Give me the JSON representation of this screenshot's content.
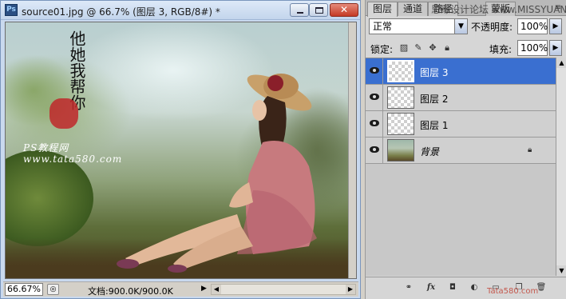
{
  "document": {
    "title": "source01.jpg @ 66.7% (图层 3, RGB/8#) *",
    "app_icon": "Ps",
    "buttons": {
      "minimize": "minimize-icon",
      "maximize": "maximize-icon",
      "close": "✕"
    },
    "image_overlay": {
      "calligraphy": "他她我帮你",
      "site_label": "PS教程网",
      "site_url": "www.tata580.com"
    },
    "status": {
      "zoom": "66.67%",
      "doc_info": "文档:900.0K/900.0K"
    }
  },
  "panel": {
    "tabs": [
      "图层",
      "通道",
      "路径",
      "蒙版"
    ],
    "watermark": "思缘设计论坛 www.MISSYUAN.COM",
    "blend_mode": "正常",
    "opacity_label": "不透明度:",
    "opacity_value": "100%",
    "lock_label": "锁定:",
    "fill_label": "填充:",
    "fill_value": "100%",
    "layers": [
      {
        "name": "图层 3",
        "selected": true,
        "type": "transparent"
      },
      {
        "name": "图层 2",
        "selected": false,
        "type": "transparent"
      },
      {
        "name": "图层 1",
        "selected": false,
        "type": "transparent"
      },
      {
        "name": "背景",
        "selected": false,
        "type": "photo",
        "locked": true
      }
    ],
    "footer_icons": [
      "link-icon",
      "fx-icon",
      "mask-icon",
      "adjustment-icon",
      "group-folder-icon",
      "new-layer-icon",
      "trash-icon"
    ],
    "footer_watermark": "Tata580.com"
  },
  "colors": {
    "selection": "#3a6fd0",
    "titlebar": "#c3d5ec",
    "panel_bg": "#d6d6d6"
  }
}
